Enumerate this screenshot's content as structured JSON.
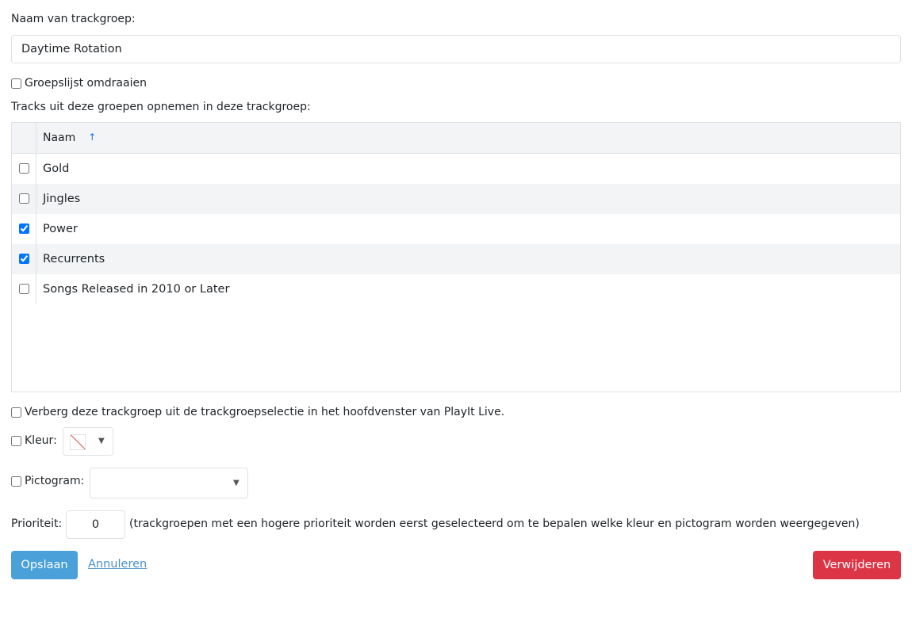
{
  "form": {
    "name_label": "Naam van trackgroep:",
    "name_value": "Daytime Rotation",
    "reverse_label": "Groepslijst omdraaien",
    "reverse_checked": false,
    "groups_label": "Tracks uit deze groepen opnemen in deze trackgroep:"
  },
  "grid": {
    "header_name": "Naam",
    "sort_icon": "↑",
    "rows": [
      {
        "label": "Gold",
        "checked": false
      },
      {
        "label": "Jingles",
        "checked": false
      },
      {
        "label": "Power",
        "checked": true
      },
      {
        "label": "Recurrents",
        "checked": true
      },
      {
        "label": "Songs Released in 2010 or Later",
        "checked": false
      }
    ]
  },
  "options": {
    "hide_label": "Verberg deze trackgroep uit de trackgroepselectie in het hoofdvenster van PlayIt Live.",
    "color_label": "Kleur:",
    "icon_label": "Pictogram:",
    "priority_label": "Prioriteit:",
    "priority_value": "0",
    "priority_help": "(trackgroepen met een hogere prioriteit worden eerst geselecteerd om te bepalen welke kleur en pictogram worden weergegeven)"
  },
  "actions": {
    "save_label": "Opslaan",
    "cancel_label": "Annuleren",
    "delete_label": "Verwijderen"
  },
  "colors": {
    "save": "#4aa0d8",
    "delete": "#dc3545",
    "link": "#4a90c9",
    "sort_icon": "#1a73e8"
  },
  "icons": {
    "sort": "arrow-up-icon",
    "color_swatch": "no-color-icon",
    "dropdown": "caret-down-icon"
  }
}
